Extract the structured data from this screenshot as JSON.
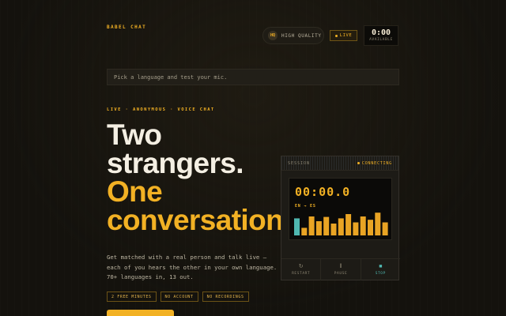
{
  "header": {
    "brand": "BABEL CHAT",
    "quality_badge": "HQ",
    "quality_label": "HIGH QUALITY",
    "live_label": "LIVE",
    "timer_value": "0:00",
    "timer_label": "AVAILABLE"
  },
  "search": {
    "placeholder": "Pick a language and test your mic."
  },
  "hero": {
    "eyebrow": "LIVE · ANONYMOUS · VOICE CHAT",
    "headline_1": "Two",
    "headline_2": "strangers.",
    "headline_3": "One",
    "headline_4": "conversation.",
    "description": "Get matched with a real person and talk live — each of you hears the other in your own language. 70+ languages in, 13 out.",
    "tags": [
      "2 FREE MINUTES",
      "NO ACCOUNT",
      "NO RECORDINGS"
    ]
  },
  "session": {
    "title": "SESSION",
    "status": "CONNECTING",
    "time": "00:00.0",
    "languages": "EN → ES",
    "meter_levels": [
      0.72,
      0.32,
      0.8,
      0.6,
      0.78,
      0.5,
      0.72,
      0.9,
      0.55,
      0.8,
      0.66,
      0.96,
      0.55
    ],
    "meter_colors": {
      "first": "#4fb7b0",
      "rest": "#e9a424"
    },
    "controls": [
      {
        "label": "RESTART",
        "icon": "↻"
      },
      {
        "label": "PAUSE",
        "icon": "‖"
      },
      {
        "label": "STOP",
        "icon": "■"
      }
    ]
  },
  "colors": {
    "accent": "#f2b124",
    "background": "#14120d",
    "teal": "#4fb7b0"
  }
}
